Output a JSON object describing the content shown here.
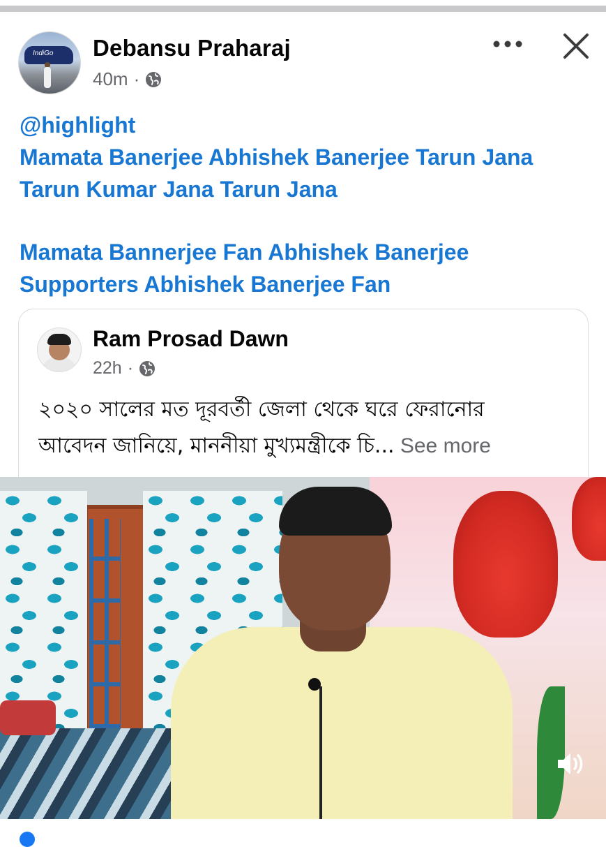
{
  "post": {
    "author_name": "Debansu Praharaj",
    "time": "40m",
    "separator": "·",
    "privacy_icon": "globe-icon",
    "more_icon": "more-dots-icon",
    "close_icon": "close-icon",
    "tags": {
      "line1": "@highlight",
      "line2": "Mamata Banerjee Abhishek Banerjee Tarun Jana",
      "line3": "Tarun Kumar Jana Tarun Jana",
      "line4": "Mamata Bannerjee Fan Abhishek Banerjee",
      "line5": "Supporters Abhishek Banerjee Fan"
    }
  },
  "shared_post": {
    "author_name": "Ram Prosad Dawn",
    "time": "22h",
    "separator": "·",
    "privacy_icon": "globe-icon",
    "text_line1": "২০২০ সালের মত দূরবর্তী জেলা থেকে ঘরে ফেরানোর",
    "text_line2": "আবেদন জানিয়ে, মাননীয়া মুখ্যমন্ত্রীকে চি...",
    "see_more": " See more"
  },
  "video": {
    "volume_icon": "volume-icon"
  },
  "colors": {
    "link_blue": "#1877d3",
    "meta_gray": "#65676b",
    "text": "#050505",
    "divider": "#c9c9cb"
  }
}
